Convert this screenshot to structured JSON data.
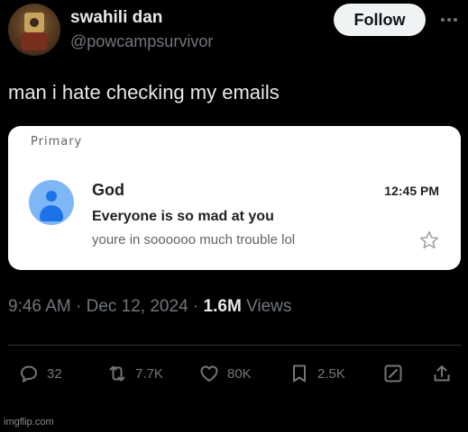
{
  "author": {
    "display_name": "swahili dan",
    "handle": "@powcampsurvivor",
    "follow_label": "Follow"
  },
  "tweet": {
    "text": "man i hate checking my emails"
  },
  "email": {
    "category": "Primary",
    "sender": "God",
    "time": "12:45 PM",
    "subject": "Everyone is so mad at you",
    "snippet": "youre in soooooo much trouble lol",
    "avatar_color": "#7fb6f5",
    "accent_color": "#1a73e8"
  },
  "meta": {
    "time": "9:46 AM",
    "separator": "·",
    "date": "Dec 12, 2024",
    "views_count": "1.6M",
    "views_label": "Views"
  },
  "actions": {
    "replies": "32",
    "reposts": "7.7K",
    "likes": "80K",
    "bookmarks": "2.5K"
  },
  "watermark": "imgflip.com",
  "colors": {
    "background": "#000000",
    "primary_text": "#e7e9ea",
    "secondary_text": "#71767b",
    "follow_bg": "#eff3f4"
  }
}
